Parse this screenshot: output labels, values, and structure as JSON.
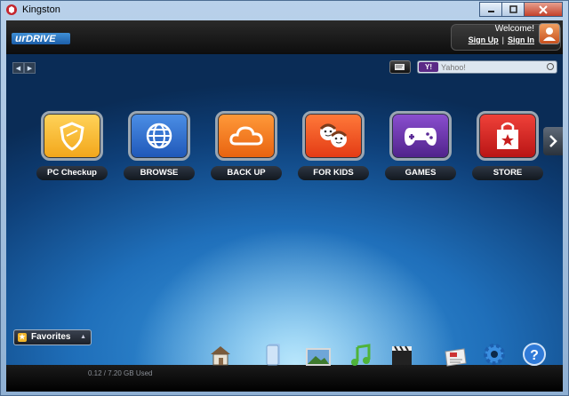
{
  "window": {
    "title": "Kingston",
    "buttons": [
      "minimize",
      "maximize",
      "close"
    ]
  },
  "header": {
    "logo_prefix": "ur",
    "logo_suffix": "DRIVE",
    "welcome": "Welcome!",
    "sign_up": "Sign Up",
    "separator": "|",
    "sign_in": "Sign In"
  },
  "toolbar": {
    "search_placeholder": "Yahoo!",
    "search_provider_label": "Y!"
  },
  "tiles": [
    {
      "label": "PC Checkup",
      "icon": "shield-icon",
      "color": "#f2b12a"
    },
    {
      "label": "BROWSE",
      "icon": "globe-icon",
      "color": "#2f6fd0"
    },
    {
      "label": "BACK UP",
      "icon": "cloud-icon",
      "color": "#f07a1a"
    },
    {
      "label": "FOR KIDS",
      "icon": "kids-faces-icon",
      "color": "#f0501e"
    },
    {
      "label": "GAMES",
      "icon": "gamepad-icon",
      "color": "#6a33a8"
    },
    {
      "label": "STORE",
      "icon": "shopping-bag-icon",
      "color": "#d42a2a"
    }
  ],
  "favorites": {
    "label": "Favorites"
  },
  "status": {
    "storage_used": "0.12 / 7.20 GB Used"
  },
  "dock": [
    {
      "name": "home-icon"
    },
    {
      "name": "documents-icon"
    },
    {
      "name": "pictures-icon"
    },
    {
      "name": "music-icon"
    },
    {
      "name": "video-icon"
    },
    {
      "name": "news-icon"
    },
    {
      "name": "settings-gear-icon"
    },
    {
      "name": "help-icon"
    }
  ]
}
